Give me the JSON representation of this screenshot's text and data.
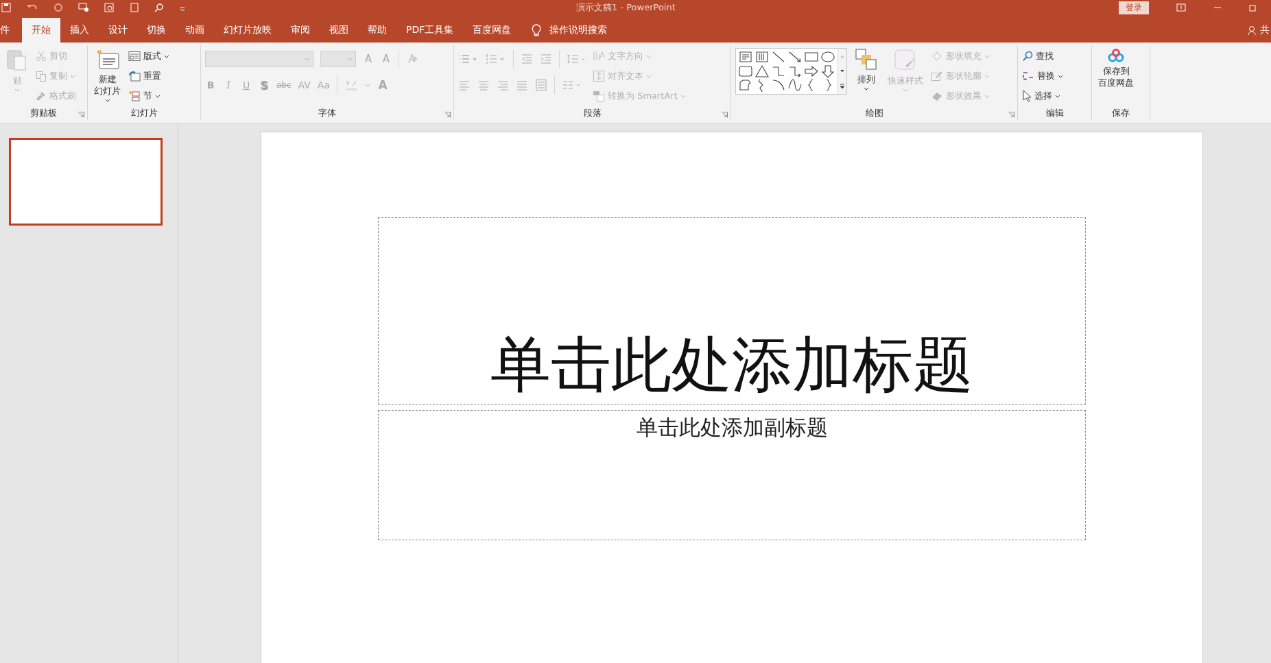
{
  "window": {
    "title": "演示文稿1 - PowerPoint",
    "sign_in": "登录"
  },
  "tabs": [
    {
      "label": "件",
      "selected": false
    },
    {
      "label": "开始",
      "selected": true
    },
    {
      "label": "插入",
      "selected": false
    },
    {
      "label": "设计",
      "selected": false
    },
    {
      "label": "切换",
      "selected": false
    },
    {
      "label": "动画",
      "selected": false
    },
    {
      "label": "幻灯片放映",
      "selected": false
    },
    {
      "label": "审阅",
      "selected": false
    },
    {
      "label": "视图",
      "selected": false
    },
    {
      "label": "帮助",
      "selected": false
    },
    {
      "label": "PDF工具集",
      "selected": false
    },
    {
      "label": "百度网盘",
      "selected": false
    }
  ],
  "tell_me": "操作说明搜索",
  "share": "共",
  "ribbon_groups": [
    {
      "label": "剪贴板",
      "launcher": true,
      "items": [
        {
          "kind": "large",
          "lines": [
            "贴"
          ],
          "disabled": true,
          "dropdown": true
        },
        {
          "kind": "small",
          "label": "剪切",
          "disabled": true,
          "dropdown": false
        },
        {
          "kind": "small",
          "label": "复制",
          "disabled": true,
          "dropdown": true
        },
        {
          "kind": "small",
          "label": "格式刷",
          "disabled": true,
          "dropdown": false
        }
      ]
    },
    {
      "label": "幻灯片",
      "launcher": false,
      "items": [
        {
          "kind": "large",
          "lines": [
            "新建",
            "幻灯片"
          ],
          "disabled": false,
          "dropdown": true
        },
        {
          "kind": "small",
          "label": "版式",
          "disabled": false,
          "dropdown": true
        },
        {
          "kind": "small",
          "label": "重置",
          "disabled": false,
          "dropdown": false
        },
        {
          "kind": "small",
          "label": "节",
          "disabled": false,
          "dropdown": true
        }
      ]
    },
    {
      "label": "字体",
      "launcher": true,
      "glyph_rows": [
        [
          "A",
          "A"
        ],
        [
          "B",
          "I",
          "U",
          "S",
          "abc",
          "AV",
          "Aa",
          "A"
        ]
      ]
    },
    {
      "label": "段落",
      "launcher": true,
      "items": [
        {
          "kind": "small",
          "label": "文字方向",
          "disabled": true,
          "dropdown": true
        },
        {
          "kind": "small",
          "label": "对齐文本",
          "disabled": true,
          "dropdown": true
        },
        {
          "kind": "small",
          "label": "转换为 SmartArt",
          "disabled": true,
          "dropdown": true
        }
      ]
    },
    {
      "label": "绘图",
      "launcher": true,
      "items": [
        {
          "kind": "large",
          "lines": [
            "排列"
          ],
          "disabled": false,
          "dropdown": true
        },
        {
          "kind": "large",
          "lines": [
            "快速样式"
          ],
          "disabled": true,
          "dropdown": true
        },
        {
          "kind": "small",
          "label": "形状填充",
          "disabled": true,
          "dropdown": true
        },
        {
          "kind": "small",
          "label": "形状轮廓",
          "disabled": true,
          "dropdown": true
        },
        {
          "kind": "small",
          "label": "形状效果",
          "disabled": true,
          "dropdown": true
        }
      ]
    },
    {
      "label": "编辑",
      "launcher": false,
      "items": [
        {
          "kind": "small",
          "label": "查找",
          "disabled": false,
          "dropdown": false
        },
        {
          "kind": "small",
          "label": "替换",
          "disabled": false,
          "dropdown": true
        },
        {
          "kind": "small",
          "label": "选择",
          "disabled": false,
          "dropdown": true
        }
      ]
    },
    {
      "label": "保存",
      "launcher": false,
      "items": [
        {
          "kind": "large",
          "lines": [
            "保存到",
            "百度网盘"
          ],
          "disabled": false,
          "dropdown": false
        }
      ]
    }
  ],
  "slides": [
    {
      "selected": true
    }
  ],
  "slide": {
    "title_placeholder": "单击此处添加标题",
    "subtitle_placeholder": "单击此处添加副标题"
  }
}
